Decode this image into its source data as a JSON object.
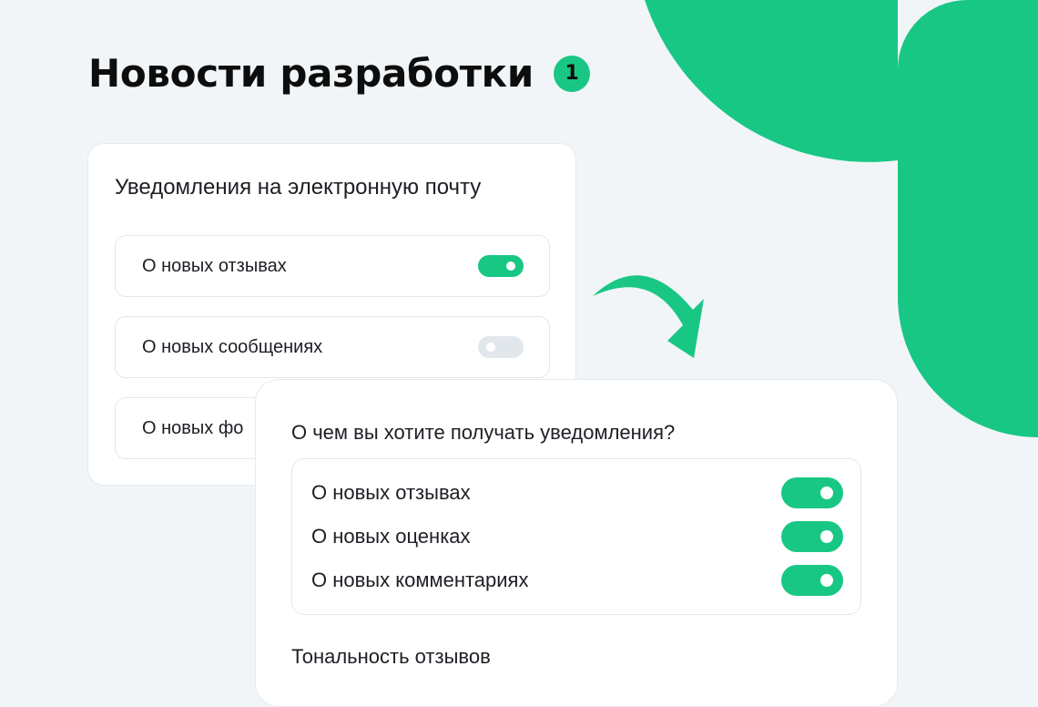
{
  "page": {
    "title": "Новости разработки",
    "badge": "1"
  },
  "colors": {
    "accent": "#19c784",
    "background": "#f1f5f8",
    "toggle_off": "#e2e7ec"
  },
  "old_settings": {
    "title": "Уведомления на электронную почту",
    "items": [
      {
        "label": "О новых отзывах",
        "enabled": true
      },
      {
        "label": "О новых сообщениях",
        "enabled": false
      },
      {
        "label": "О новых фо",
        "enabled": null
      }
    ]
  },
  "new_settings": {
    "question": "О чем вы хотите получать уведомления?",
    "items": [
      {
        "label": "О новых отзывах",
        "enabled": true
      },
      {
        "label": "О новых оценках",
        "enabled": true
      },
      {
        "label": "О новых комментариях",
        "enabled": true
      }
    ],
    "tone_label": "Тональность отзывов"
  },
  "icons": {
    "arrow": "curved-arrow-down-right-icon"
  }
}
